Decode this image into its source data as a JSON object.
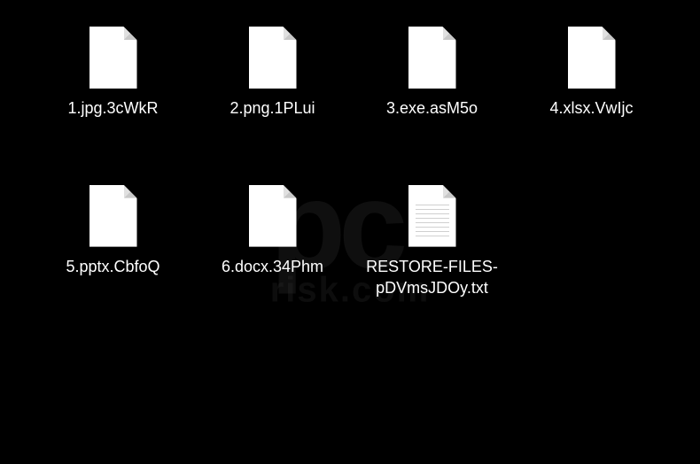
{
  "watermark": {
    "main": "pc",
    "sub": "risk.com"
  },
  "files": [
    {
      "name": "1.jpg.3cWkR",
      "icon": "blank"
    },
    {
      "name": "2.png.1PLui",
      "icon": "blank"
    },
    {
      "name": "3.exe.asM5o",
      "icon": "blank"
    },
    {
      "name": "4.xlsx.VwIjc",
      "icon": "blank"
    },
    {
      "name": "5.pptx.CbfoQ",
      "icon": "blank"
    },
    {
      "name": "6.docx.34Phm",
      "icon": "blank"
    },
    {
      "name": "RESTORE-FILES-pDVmsJDOy.txt",
      "icon": "text"
    }
  ]
}
